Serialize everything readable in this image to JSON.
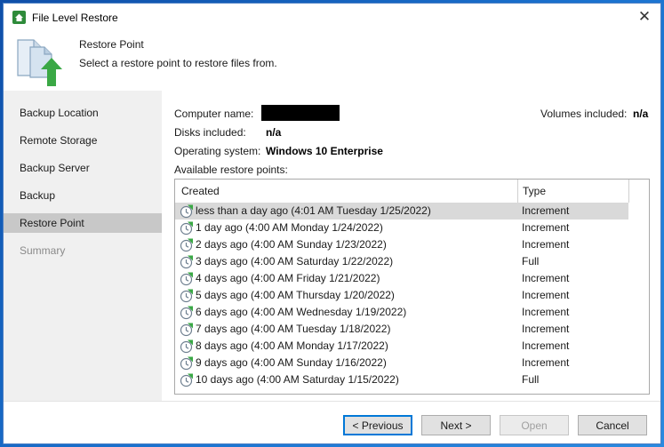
{
  "window": {
    "title": "File Level Restore",
    "close_glyph": "✕"
  },
  "header": {
    "title": "Restore Point",
    "description": "Select a restore point to restore files from.",
    "icon": "restore-wizard-icon"
  },
  "sidebar": {
    "items": [
      {
        "label": "Backup Location",
        "state": "normal"
      },
      {
        "label": "Remote Storage",
        "state": "normal"
      },
      {
        "label": "Backup Server",
        "state": "normal"
      },
      {
        "label": "Backup",
        "state": "normal"
      },
      {
        "label": "Restore Point",
        "state": "active"
      },
      {
        "label": "Summary",
        "state": "disabled"
      }
    ]
  },
  "info": {
    "computer_name_label": "Computer name:",
    "volumes_label": "Volumes included:",
    "volumes_value": "n/a",
    "disks_label": "Disks included:",
    "disks_value": "n/a",
    "os_label": "Operating system:",
    "os_value": "Windows 10 Enterprise",
    "restore_points_label": "Available restore points:"
  },
  "list": {
    "columns": {
      "created": "Created",
      "type": "Type"
    },
    "selected_index": 0,
    "rows": [
      {
        "created": "less than a day ago (4:01 AM Tuesday 1/25/2022)",
        "type": "Increment"
      },
      {
        "created": "1 day ago (4:00 AM Monday 1/24/2022)",
        "type": "Increment"
      },
      {
        "created": "2 days ago (4:00 AM Sunday 1/23/2022)",
        "type": "Increment"
      },
      {
        "created": "3 days ago (4:00 AM Saturday 1/22/2022)",
        "type": "Full"
      },
      {
        "created": "4 days ago (4:00 AM Friday 1/21/2022)",
        "type": "Increment"
      },
      {
        "created": "5 days ago (4:00 AM Thursday 1/20/2022)",
        "type": "Increment"
      },
      {
        "created": "6 days ago (4:00 AM Wednesday 1/19/2022)",
        "type": "Increment"
      },
      {
        "created": "7 days ago (4:00 AM Tuesday 1/18/2022)",
        "type": "Increment"
      },
      {
        "created": "8 days ago (4:00 AM Monday 1/17/2022)",
        "type": "Increment"
      },
      {
        "created": "9 days ago (4:00 AM Sunday 1/16/2022)",
        "type": "Increment"
      },
      {
        "created": "10 days ago (4:00 AM Saturday 1/15/2022)",
        "type": "Full"
      }
    ]
  },
  "buttons": {
    "previous": "< Previous",
    "next": "Next >",
    "open": "Open",
    "cancel": "Cancel"
  },
  "colors": {
    "accent": "#0078d7",
    "icon_green": "#3aa845",
    "selection": "#d9d9d9"
  }
}
